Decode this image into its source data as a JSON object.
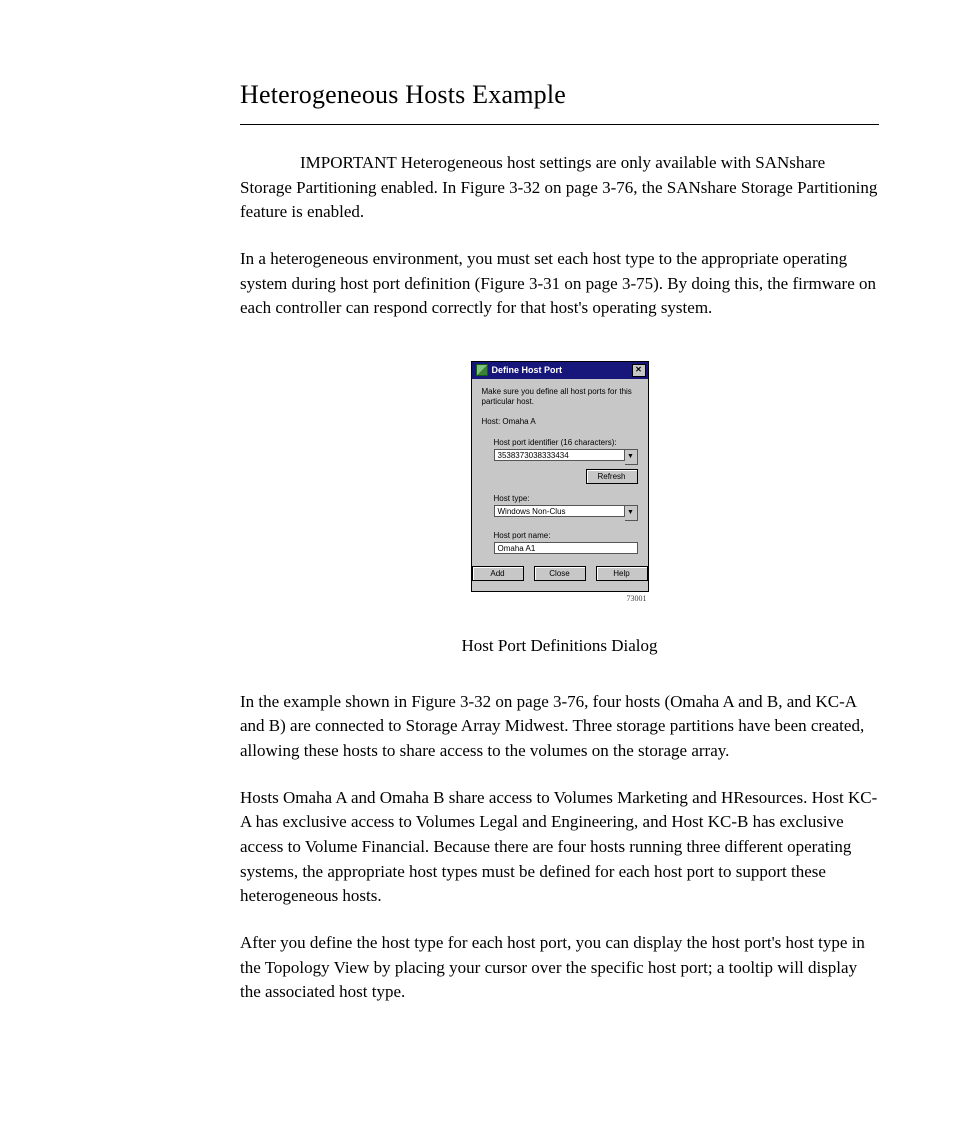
{
  "title": "Heterogeneous Hosts Example",
  "para1": "IMPORTANT Heterogeneous host settings are only available with SANshare Storage Partitioning enabled. In Figure 3-32 on page 3-76, the SANshare Storage Partitioning feature is enabled.",
  "para2": "In a heterogeneous environment, you must set each host type to the appropriate operating system during host port definition (Figure 3-31 on page 3-75). By doing this, the firmware on each controller can respond correctly for that host's operating system.",
  "dialog": {
    "title": "Define Host Port",
    "close_glyph": "✕",
    "msg": "Make sure you define all host ports for this particular host.",
    "host_line": "Host: Omaha A",
    "id_label": "Host port identifier (16 characters):",
    "id_value": "3538373038333434",
    "refresh": "Refresh",
    "type_label": "Host type:",
    "type_value": "Windows Non-Clus",
    "name_label": "Host port name:",
    "name_value": "Omaha A1",
    "btn_add": "Add",
    "btn_close": "Close",
    "btn_help": "Help",
    "figno": "73001"
  },
  "caption": "Host Port Definitions Dialog",
  "para3": "In the example shown in Figure 3-32 on page 3-76, four hosts (Omaha A and B, and KC-A and B) are connected to Storage Array Midwest. Three storage partitions have been created, allowing these hosts to share access to the volumes on the storage array.",
  "para4": "Hosts Omaha A and Omaha B share access to Volumes Marketing and HResources. Host KC-A has exclusive access to Volumes Legal and Engineering, and Host KC-B has exclusive access to Volume Financial. Because there are four hosts running three different operating systems, the appropriate host types must be defined for each host port to support these heterogeneous hosts.",
  "para5": "After you define the host type for each host port, you can display the host port's host type in the Topology View by placing your cursor over the specific host port; a tooltip will display the associated host type."
}
